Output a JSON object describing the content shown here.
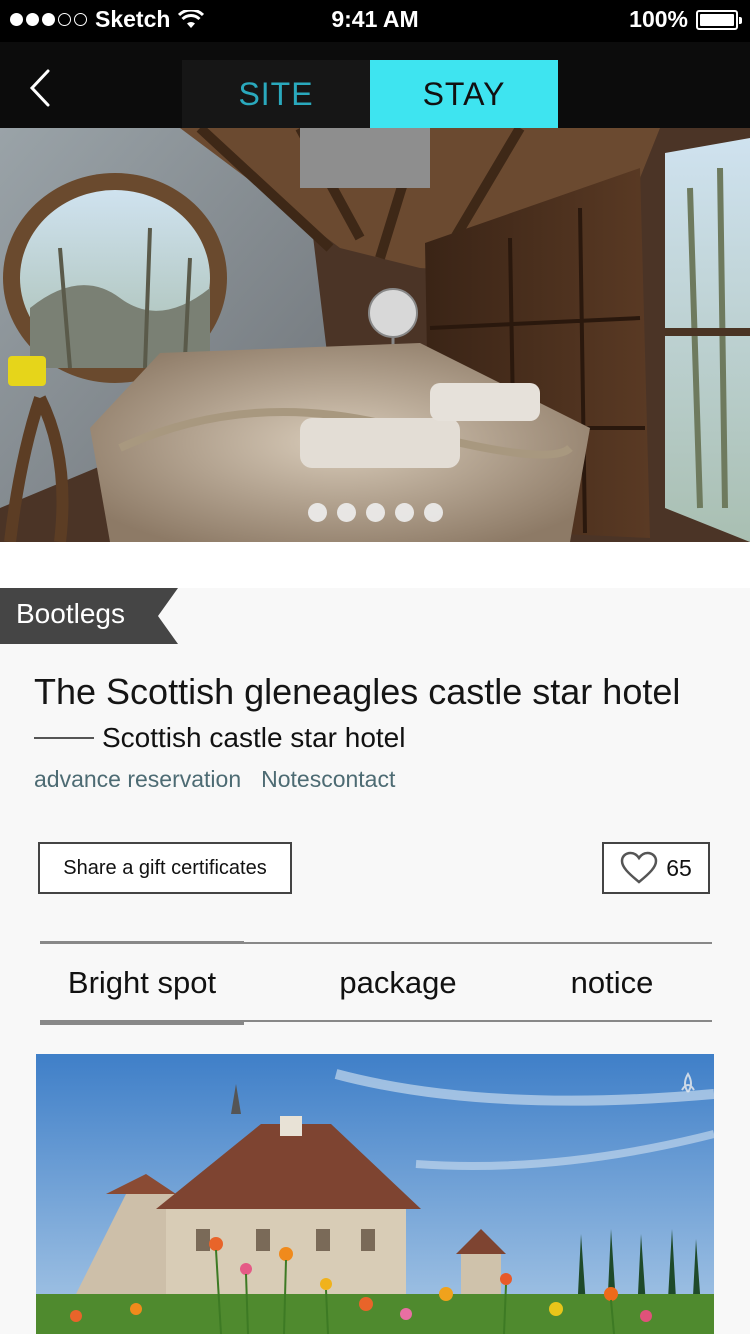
{
  "status_bar": {
    "carrier": "Sketch",
    "time": "9:41 AM",
    "battery": "100%"
  },
  "nav": {
    "tabs": [
      {
        "label": "SITE",
        "selected": false
      },
      {
        "label": "STAY",
        "selected": true
      }
    ]
  },
  "hero": {
    "page_count": 5
  },
  "listing": {
    "ribbon": "Bootlegs",
    "title": "The Scottish gleneagles castle star hotel",
    "subtitle": "Scottish castle star hotel",
    "links": [
      "advance reservation",
      "Notescontact"
    ],
    "gift_button": "Share a gift certificates",
    "like_count": "65"
  },
  "section_tabs": [
    {
      "label": "Bright spot",
      "selected": true
    },
    {
      "label": "package",
      "selected": false
    },
    {
      "label": "notice",
      "selected": false
    }
  ],
  "colors": {
    "accent": "#3ee4f0",
    "site_text": "#2aa9bd",
    "link": "#4d6b73"
  }
}
